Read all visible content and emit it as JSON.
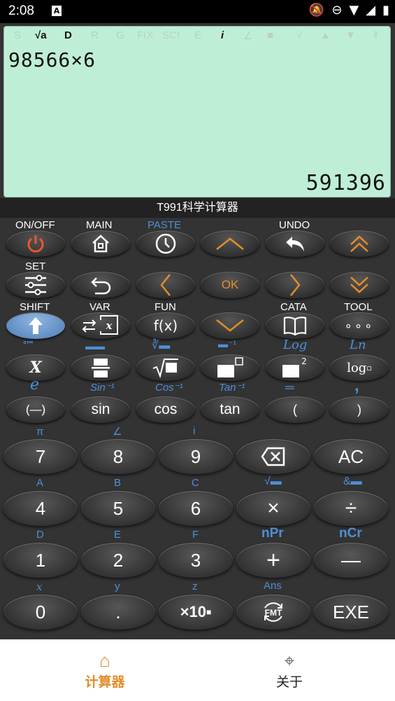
{
  "status": {
    "time": "2:08",
    "a_icon": "A"
  },
  "lcd": {
    "flags": [
      "S",
      "√a",
      "D",
      "R",
      "G",
      "FIX",
      "SCI",
      "E",
      "i",
      "∠"
    ],
    "expression": "98566×6",
    "result": "591396"
  },
  "app_title": "T991科学计算器",
  "func_keys": {
    "row1": {
      "on_off": "ON/OFF",
      "main": "MAIN",
      "paste": "PASTE",
      "undo": "UNDO"
    },
    "row2": {
      "set": "SET",
      "ok": "OK"
    },
    "row3": {
      "shift": "SHIFT",
      "var": "VAR",
      "fun": "FUN",
      "cata": "CATA",
      "tool": "TOOL"
    },
    "row4": {
      "log": "Log",
      "ln": "Ln",
      "x_key": "X",
      "log_key": "log"
    },
    "row5": {
      "e": "e",
      "sin_inv": "Sin⁻¹",
      "cos_inv": "Cos⁻¹",
      "tan_inv": "Tan⁻¹",
      "comma": ","
    },
    "row6": {
      "neg": "(—)",
      "sin": "sin",
      "cos": "cos",
      "tan": "tan",
      "lparen": "(",
      "rparen": ")"
    }
  },
  "main_keys": {
    "secondary_row1": [
      "π",
      "∠",
      "i"
    ],
    "row1": [
      "7",
      "8",
      "9",
      "⌫",
      "AC"
    ],
    "secondary_row2": [
      "A",
      "B",
      "C"
    ],
    "row2": [
      "4",
      "5",
      "6",
      "×",
      "÷"
    ],
    "secondary_row3": [
      "D",
      "E",
      "F",
      "nPr",
      "nCr"
    ],
    "row3": [
      "1",
      "2",
      "3",
      "+",
      "—"
    ],
    "secondary_row4": [
      "x",
      "y",
      "z",
      "Ans"
    ],
    "row4": [
      "0",
      ".",
      "×10",
      "FMT",
      "EXE"
    ]
  },
  "nav": {
    "calculator": "计算器",
    "about": "关于"
  },
  "colors": {
    "lcd": "#bfeed6",
    "accent": "#e38c2b",
    "blue": "#4d8fd6"
  }
}
